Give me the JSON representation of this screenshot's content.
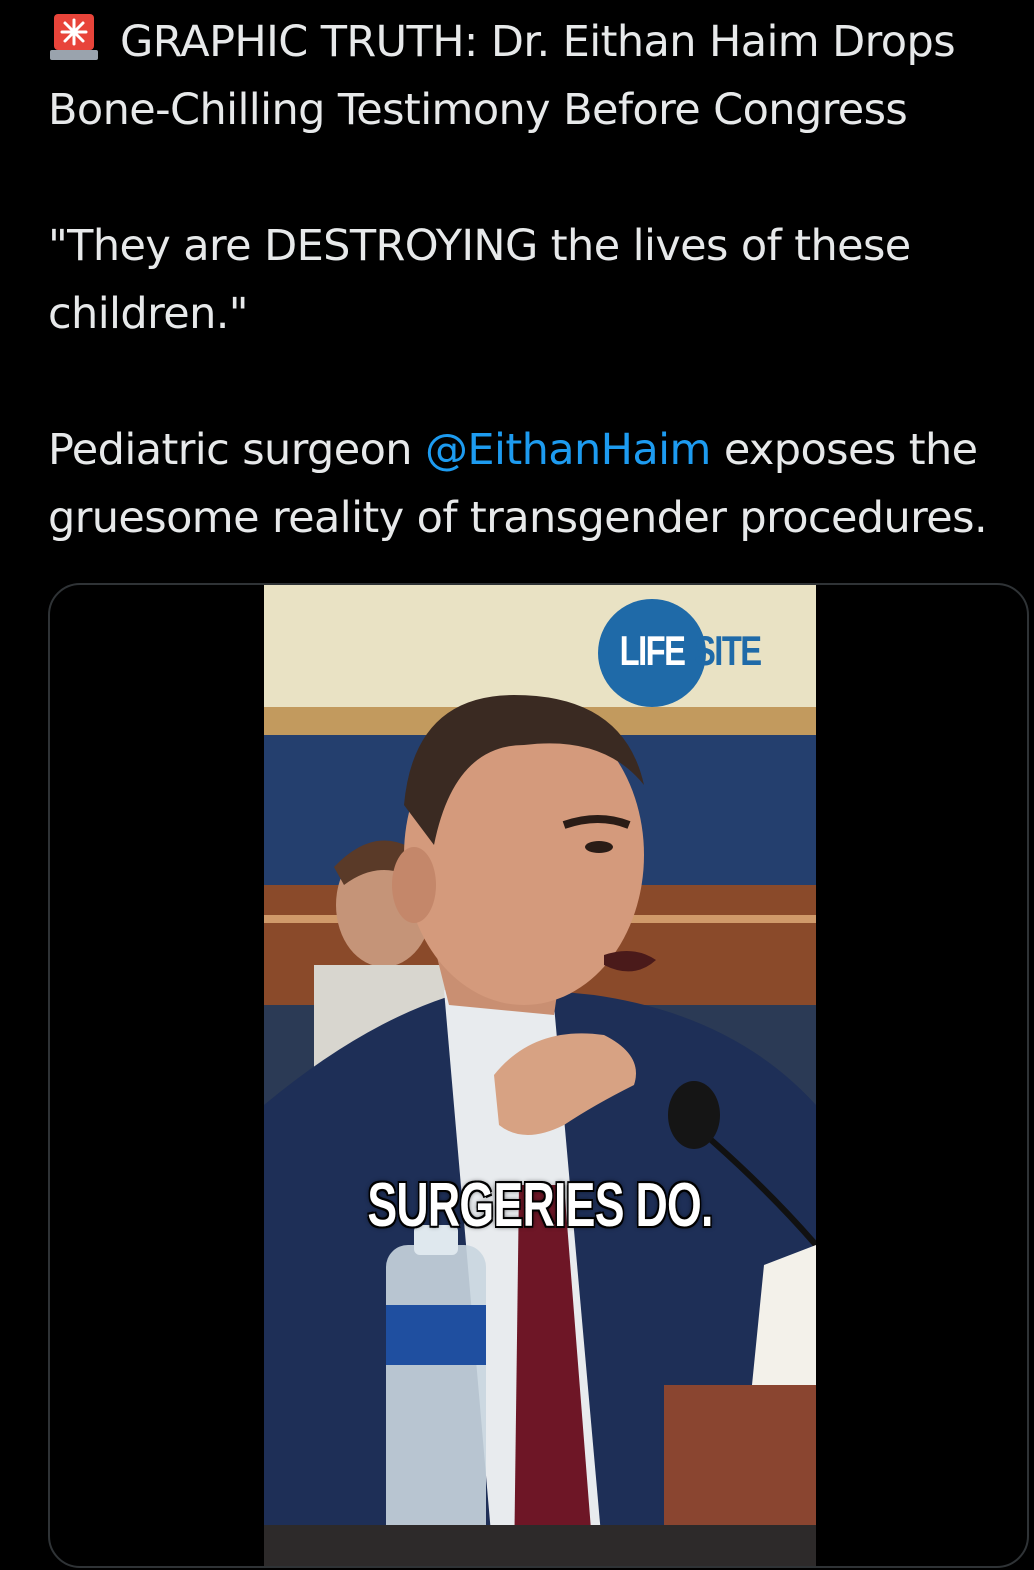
{
  "tweet": {
    "headline": "GRAPHIC TRUTH: Dr. Eithan Haim Drops Bone-Chilling Testimony Before Congress",
    "headline_icon": "rotating-light-emoji-icon",
    "quote": "\"They are DESTROYING the lives of these children.\"",
    "body_before_mention": "Pediatric surgeon ",
    "mention": "@EithanHaim",
    "body_after_mention": " exposes the gruesome reality of transgender procedures."
  },
  "media": {
    "logo_left": "LIFE",
    "logo_right": "SITE",
    "caption": "SURGERIES DO.",
    "video_icon": "video-player"
  },
  "colors": {
    "background": "#000000",
    "text": "#e7e9ea",
    "link": "#1d9bf0",
    "card_border": "#2f3336",
    "logo_blue": "#1f6aa8"
  }
}
